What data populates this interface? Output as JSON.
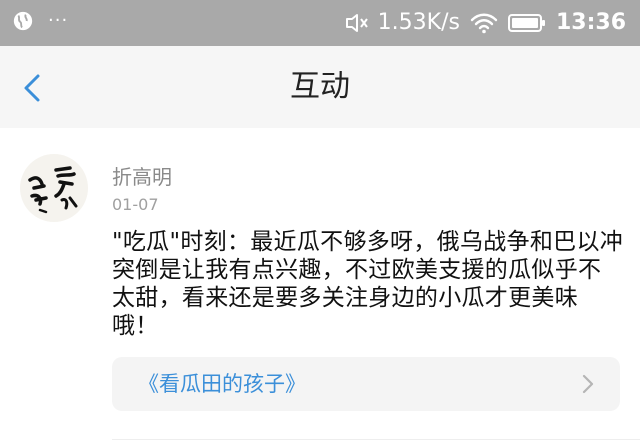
{
  "status_bar": {
    "dots": "···",
    "net_speed": "1.53K/s",
    "time": "13:36",
    "icons": [
      "globe-icon",
      "mute-icon",
      "wifi-icon",
      "battery-icon"
    ]
  },
  "nav": {
    "title": "互动",
    "back_icon": "chevron-left-icon"
  },
  "post": {
    "author": "折高明",
    "date": "01-07",
    "content": "\"吃瓜\"时刻：最近瓜不够多呀，俄乌战争和巴以冲突倒是让我有点兴趣，不过欧美支援的瓜似乎不太甜，看来还是要多关注身边的小瓜才更美味哦！",
    "link_title": "《看瓜田的孩子》",
    "link_icon": "chevron-right-icon"
  },
  "colors": {
    "status_bar_bg": "#a9a9a9",
    "nav_bg": "#f6f6f6",
    "accent": "#3b8fd9",
    "link_card_bg": "#f4f4f4"
  }
}
